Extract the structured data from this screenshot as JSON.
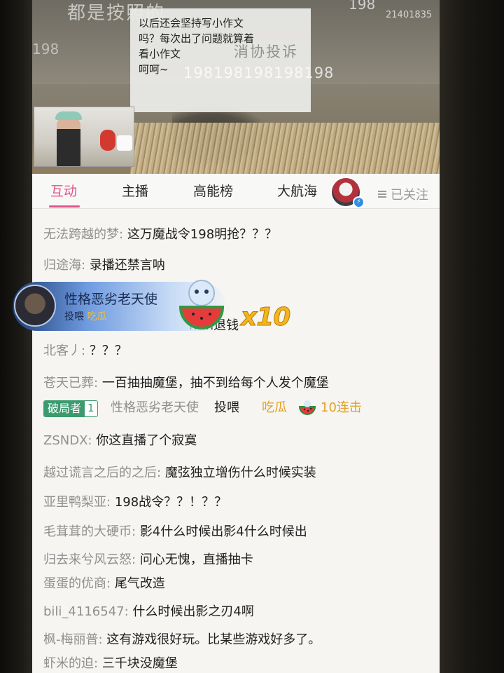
{
  "video": {
    "overlay_top_left": "都是按照的",
    "overlay_num_left": "198",
    "overlay_num_top": "198",
    "room_uid": "21401835",
    "notice_lines": [
      "以后还会坚持写小作文",
      "吗？每次出了问题就算着",
      "看小作文",
      "呵呵~"
    ],
    "overlay_ban": "消协投诉",
    "overlay_nums": "198198198198198"
  },
  "tabs": [
    {
      "label": "互动",
      "active": true
    },
    {
      "label": "主播",
      "active": false
    },
    {
      "label": "高能榜",
      "active": false
    },
    {
      "label": "大航海",
      "active": false
    }
  ],
  "follow_label": "已关注",
  "accent_color": "#e2548a",
  "chat": [
    {
      "user": "无法跨越的梦:",
      "text": "这万魔战令198明抢？？？"
    },
    {
      "user": "归途海:",
      "text": "录播还禁言呐"
    },
    {
      "user": "",
      "text": "mm退钱"
    },
    {
      "user": "北客丿:",
      "text": "？？？"
    },
    {
      "user": "苍天已葬:",
      "text": "一百抽抽魔堡，抽不到给每个人发个魔堡"
    },
    {
      "user": "ZSNDX:",
      "text": "你这直播了个寂寞"
    },
    {
      "user": "越过谎言之后的之后:",
      "text": "魔弦独立增伤什么时候实装"
    },
    {
      "user": "亚里鸭梨亚:",
      "text": "198战令？？！？？"
    },
    {
      "user": "毛茸茸的大硬币:",
      "text": "影4什么时候出影4什么时候出"
    },
    {
      "user": "归去来兮风云怒:",
      "text": "问心无愧，直播抽卡"
    },
    {
      "user": "蛋蛋的优商:",
      "text": "尾气改造"
    },
    {
      "user": "bili_4116547:",
      "text": "什么时候出影之刃4啊"
    },
    {
      "user": "枫-梅丽普:",
      "text": "这有游戏很好玩。比某些游戏好多了。"
    },
    {
      "user": "虾米的迫:",
      "text": "三千块没魔堡"
    }
  ],
  "gift_message": {
    "medal_name": "破局者",
    "medal_level": "1",
    "user": "性格恶劣老天使",
    "action": "投喂",
    "gift": "吃瓜",
    "combo": "10连击",
    "gift_icon": "watermelon-icon"
  },
  "gift_banner": {
    "user": "性格恶劣老天使",
    "action": "投喂",
    "gift": "吃瓜",
    "count": "x10",
    "mascot_icon": "watermelon-mascot-icon"
  }
}
